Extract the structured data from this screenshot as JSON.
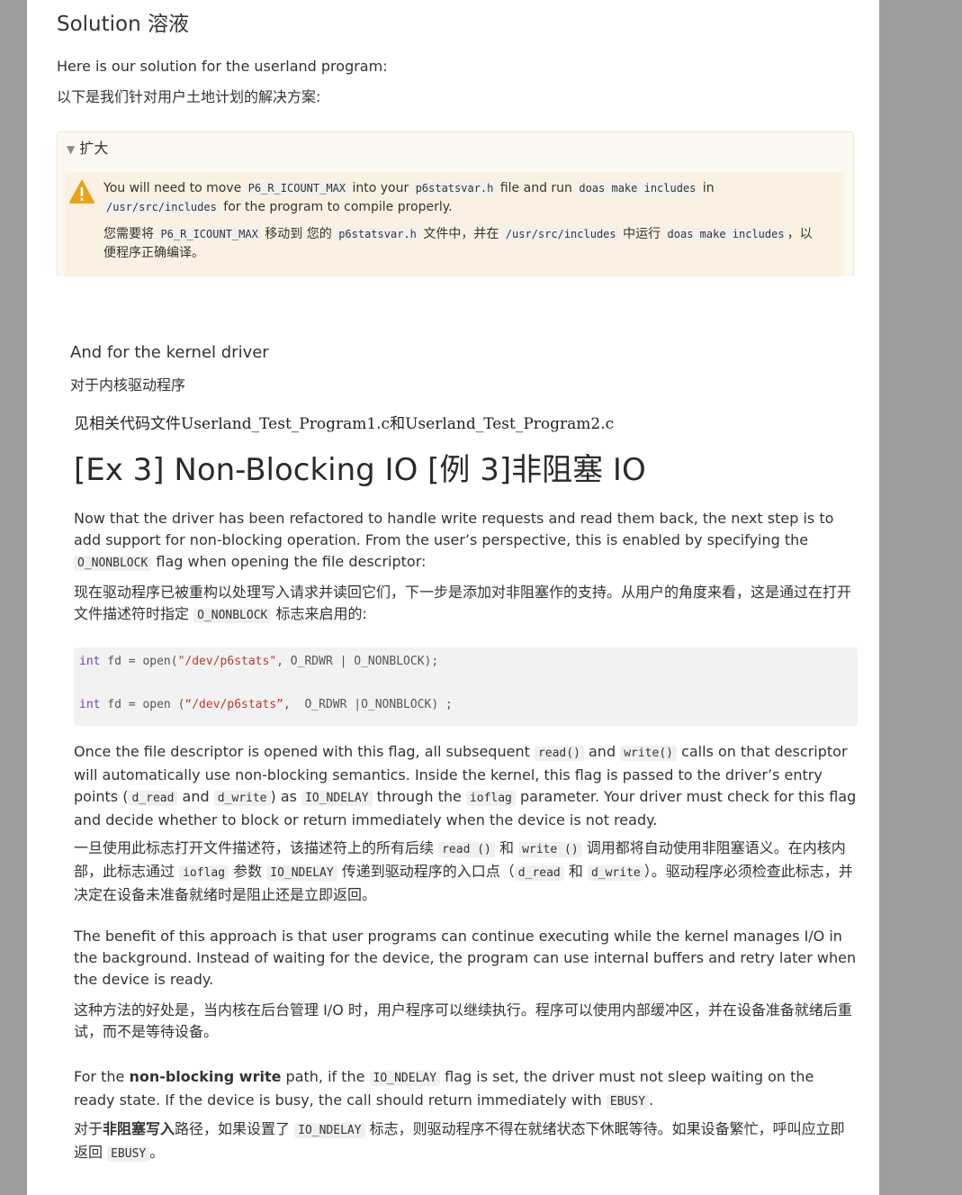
{
  "solution": {
    "heading": "Solution  溶液",
    "intro_en": "Here is our solution for the userland program:",
    "intro_zh": "以下是我们针对用户土地计划的解决方案:"
  },
  "details": {
    "summary": "扩大",
    "warning_icon": "warning-triangle-icon",
    "en": {
      "p1": "You will need to move ",
      "c1": "P6_R_ICOUNT_MAX",
      "p2": " into your ",
      "c2": "p6statsvar.h",
      "p3": " file and run ",
      "c3": "doas make includes",
      "p4": " in",
      "c4": "/usr/src/includes",
      "p5": " for the program to compile properly."
    },
    "zh": {
      "p1": "您需要将 ",
      "c1": "P6_R_ICOUNT_MAX",
      "p2": " 移动到 您的 ",
      "c2": "p6statsvar.h",
      "p3": " 文件中，并在 ",
      "c3": "/usr/src/includes",
      "p4": " 中运行 ",
      "c4": "doas make includes",
      "p5": "，以",
      "p6": "便程序正确编译。"
    }
  },
  "kernel": {
    "en": "And for the kernel driver",
    "zh": "对于内核驱动程序",
    "note": "见相关代码文件Userland_Test_Program1.c和Userland_Test_Program2.c"
  },
  "ex3": {
    "title": "[Ex 3] Non-Blocking IO  [例 3]非阻塞 IO",
    "p1_en_a": "Now that the driver has been refactored to handle write requests and read them back, the next step is to add support for non-blocking operation. From the user’s perspective, this is enabled by specifying the ",
    "p1_en_code": "O_NONBLOCK",
    "p1_en_b": " flag when opening the file descriptor:",
    "p1_zh_a": "现在驱动程序已被重构以处理写入请求并读回它们，下一步是添加对非阻塞作的支持。从用户的角度来看，这是通过在打开文件描述符时指定 ",
    "p1_zh_code": "O_NONBLOCK",
    "p1_zh_b": " 标志来启用的:",
    "code": {
      "line1_kw": "int",
      "line1_a": " fd = open(",
      "line1_str": "\"/dev/p6stats\"",
      "line1_b": ", O_RDWR | O_NONBLOCK);",
      "line2_kw": "int",
      "line2_a": " fd = open (",
      "line2_str": "“/dev/p6stats”",
      "line2_b": ",  O_RDWR |O_NONBLOCK) ;"
    },
    "p2_en": {
      "a": "Once the file descriptor is opened with this flag, all subsequent ",
      "c1": "read()",
      "b": " and ",
      "c2": "write()",
      "c": " calls on that descriptor will automatically use non-blocking semantics. Inside the kernel, this flag is passed to the driver’s entry points (",
      "c3": "d_read",
      "d": " and ",
      "c4": "d_write",
      "e": ") as ",
      "c5": "IO_NDELAY",
      "f": " through the ",
      "c6": "ioflag",
      "g": " parameter. Your driver must check for this flag and decide whether to block or return immediately when the device is not ready."
    },
    "p2_zh": {
      "a": "一旦使用此标志打开文件描述符，该描述符上的所有后续 ",
      "c1": "read ()",
      "b": " 和 ",
      "c2": "write ()",
      "c": " 调用都将自动使用非阻塞语义。在内核内部，此标志通过 ",
      "c3": "ioflag",
      "d": " 参数 ",
      "c4": "IO_NDELAY",
      "e": " 传递到驱动程序的入口点（",
      "c5": "d_read",
      "f": " 和 ",
      "c6": "d_write",
      "g": "）。驱动程序必须检查此标志，并决定在设备未准备就绪时是阻止还是立即返回。"
    },
    "p3_en": "The benefit of this approach is that user programs can continue executing while the kernel manages I/O in the background. Instead of waiting for the device, the program can use internal buffers and retry later when the device is ready.",
    "p3_zh": "这种方法的好处是，当内核在后台管理 I/O 时，用户程序可以继续执行。程序可以使用内部缓冲区，并在设备准备就绪后重试，而不是等待设备。",
    "p4_en": {
      "a": "For the ",
      "bold": "non-blocking write",
      "b": " path, if the ",
      "c1": "IO_NDELAY",
      "c": " flag is set, the driver must not sleep waiting on the ready state. If the device is busy, the call should return immediately with ",
      "c2": "EBUSY",
      "d": "."
    },
    "p4_zh": {
      "a": "对于",
      "bold": "非阻塞写入",
      "b": "路径，如果设置了 ",
      "c1": "IO_NDELAY",
      "c": " 标志，则驱动程序不得在就绪状态下休眠等待。如果设备繁忙，呼叫应立即返回 ",
      "c2": "EBUSY",
      "d": "。"
    }
  }
}
